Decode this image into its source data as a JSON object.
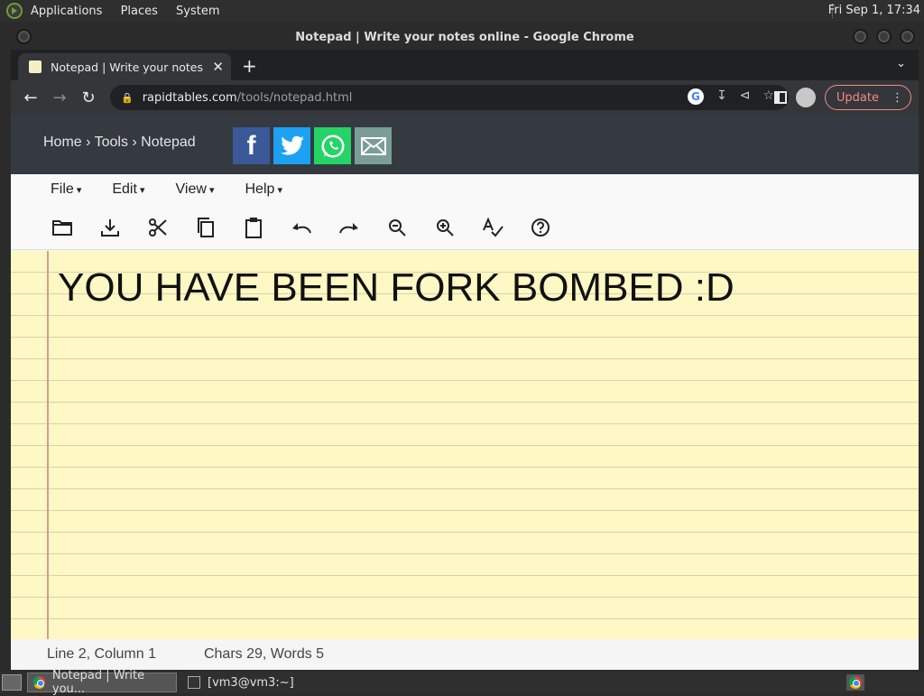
{
  "top_panel": {
    "menus": [
      "Applications",
      "Places",
      "System"
    ],
    "clock": "Fri Sep  1, 17:34"
  },
  "window": {
    "title": "Notepad | Write your notes online - Google Chrome"
  },
  "tab": {
    "title": "Notepad | Write your notes onl",
    "close": "✕",
    "new_tab": "+"
  },
  "address_bar": {
    "host": "rapidtables.com",
    "path": "/tools/notepad.html",
    "update_label": "Update"
  },
  "site": {
    "breadcrumb": "Home › Tools › Notepad",
    "share": [
      "f",
      "t",
      "w",
      "✉"
    ]
  },
  "menu": {
    "items": [
      "File",
      "Edit",
      "View",
      "Help"
    ]
  },
  "toolbar_icons": [
    "open-folder-icon",
    "download-icon",
    "cut-icon",
    "copy-icon",
    "paste-icon",
    "undo-icon",
    "redo-icon",
    "zoom-out-icon",
    "zoom-in-icon",
    "spellcheck-icon",
    "help-icon"
  ],
  "editor": {
    "text": "YOU HAVE BEEN FORK BOMBED :D"
  },
  "status": {
    "position": "Line 2, Column 1",
    "counts": "Chars 29, Words 5"
  },
  "taskbar": {
    "items": [
      "Notepad | Write you...",
      "[vm3@vm3:~]"
    ]
  },
  "colors": {
    "paper": "#fdf8c4",
    "header": "#343a40",
    "update_accent": "#f28b82"
  }
}
